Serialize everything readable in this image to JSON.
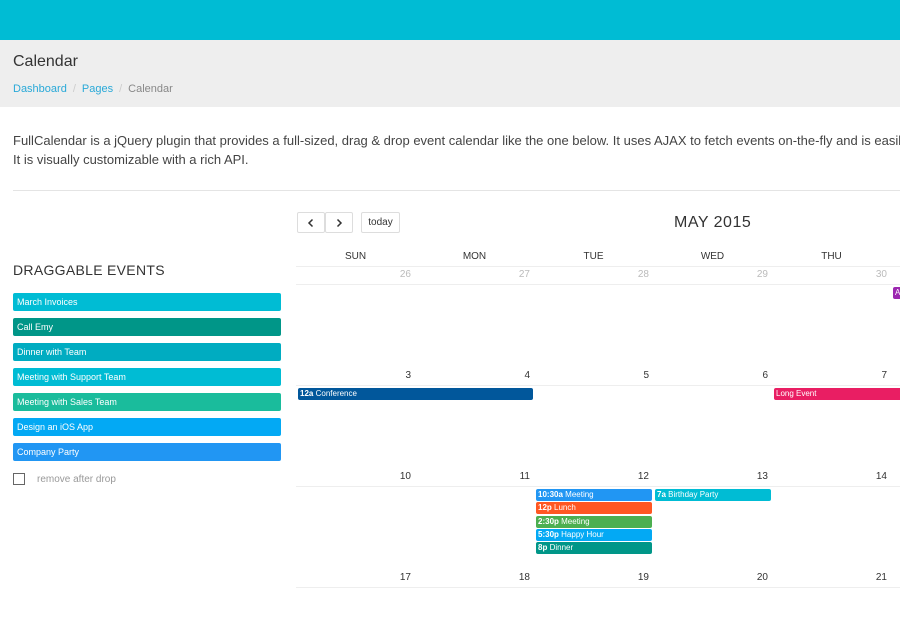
{
  "header": {
    "title": "Calendar"
  },
  "breadcrumb": [
    "Dashboard",
    "Pages",
    "Calendar"
  ],
  "intro": {
    "line1": "FullCalendar is a jQuery plugin that provides a full-sized, drag & drop event calendar like the one below. It uses AJAX to fetch events on-the-fly and is easily c",
    "line2": "It is visually customizable with a rich API."
  },
  "draggable": {
    "title": "DRAGGABLE EVENTS",
    "items": [
      {
        "label": "March Invoices",
        "color": "#00bcd4"
      },
      {
        "label": "Call Emy",
        "color": "#009688"
      },
      {
        "label": "Dinner with Team",
        "color": "#00acc1"
      },
      {
        "label": "Meeting with Support Team",
        "color": "#00bcd4"
      },
      {
        "label": "Meeting with Sales Team",
        "color": "#1abc9c"
      },
      {
        "label": "Design an iOS App",
        "color": "#03a9f4"
      },
      {
        "label": "Company Party",
        "color": "#2196f3"
      }
    ],
    "remove_label": "remove after drop"
  },
  "toolbar": {
    "prev": "<",
    "next": ">",
    "today": "today",
    "month": "MAY 2015"
  },
  "calendar": {
    "days_of_week": [
      "SUN",
      "MON",
      "TUE",
      "WED",
      "THU"
    ],
    "weeks": [
      [
        {
          "n": "26",
          "other": true
        },
        {
          "n": "27",
          "other": true
        },
        {
          "n": "28",
          "other": true
        },
        {
          "n": "29",
          "other": true
        },
        {
          "n": "30",
          "other": true
        }
      ],
      [
        {
          "n": "3"
        },
        {
          "n": "4"
        },
        {
          "n": "5"
        },
        {
          "n": "6"
        },
        {
          "n": "7"
        }
      ],
      [
        {
          "n": "10"
        },
        {
          "n": "11"
        },
        {
          "n": "12"
        },
        {
          "n": "13"
        },
        {
          "n": "14"
        }
      ],
      [
        {
          "n": "17"
        },
        {
          "n": "18"
        },
        {
          "n": "19"
        },
        {
          "n": "20"
        },
        {
          "n": "21"
        }
      ]
    ],
    "events": [
      {
        "time": "",
        "title": "A",
        "color": "#9c27b0",
        "week": 0,
        "col": 5,
        "span": 1,
        "slot": 0
      },
      {
        "time": "12a",
        "title": "Conference",
        "color": "#01579b",
        "week": 1,
        "col": 0,
        "span": 2,
        "slot": 0
      },
      {
        "time": "",
        "title": "Long Event",
        "color": "#e91e63",
        "week": 1,
        "col": 4,
        "span": 2,
        "slot": 0
      },
      {
        "time": "10:30a",
        "title": "Meeting",
        "color": "#2196f3",
        "week": 2,
        "col": 2,
        "span": 1,
        "slot": 0
      },
      {
        "time": "7a",
        "title": "Birthday Party",
        "color": "#00bcd4",
        "week": 2,
        "col": 3,
        "span": 1,
        "slot": 0
      },
      {
        "time": "12p",
        "title": "Lunch",
        "color": "#ff5722",
        "week": 2,
        "col": 2,
        "span": 1,
        "slot": 1
      },
      {
        "time": "2:30p",
        "title": "Meeting",
        "color": "#4caf50",
        "week": 2,
        "col": 2,
        "span": 1,
        "slot": 2
      },
      {
        "time": "5:30p",
        "title": "Happy Hour",
        "color": "#03a9f4",
        "week": 2,
        "col": 2,
        "span": 1,
        "slot": 3
      },
      {
        "time": "8p",
        "title": "Dinner",
        "color": "#009688",
        "week": 2,
        "col": 2,
        "span": 1,
        "slot": 4
      }
    ]
  }
}
